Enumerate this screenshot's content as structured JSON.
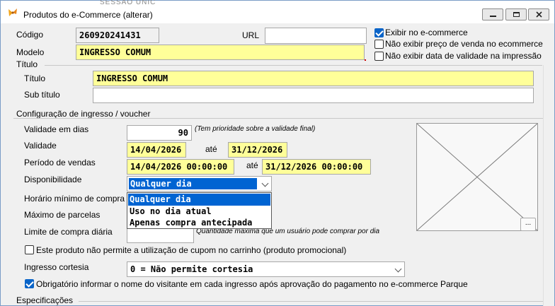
{
  "window": {
    "title": "Produtos do e-Commerce (alterar)",
    "background_text": "SESSAO UNIC"
  },
  "form": {
    "codigo_label": "Código",
    "codigo_value": "260920241431",
    "url_label": "URL",
    "url_value": "",
    "modelo_label": "Modelo",
    "modelo_value": "INGRESSO COMUM",
    "exibir_ecommerce_label": "Exibir no e-commerce",
    "exibir_ecommerce_checked": true,
    "nao_exibir_preco_label": "Não exibir preço de venda no ecommerce",
    "nao_exibir_preco_checked": false,
    "nao_exibir_validade_label": "Não exibir data de validade na impressão",
    "nao_exibir_validade_checked": false
  },
  "titulo_group": {
    "legend": "Título",
    "titulo_label": "Título",
    "titulo_value": "INGRESSO COMUM",
    "subtitulo_label": "Sub título",
    "subtitulo_value": ""
  },
  "config_group": {
    "legend": "Configuração de ingresso / voucher",
    "validade_dias_label": "Validade em dias",
    "validade_dias_value": "90",
    "validade_dias_hint": "(Tem prioridade sobre a validade final)",
    "validade_label": "Validade",
    "validade_inicio": "14/04/2026",
    "ate_label": "até",
    "validade_fim": "31/12/2026",
    "periodo_label": "Período de vendas",
    "periodo_inicio": "14/04/2026 00:00:00",
    "periodo_ate_label": "até",
    "periodo_fim": "31/12/2026 00:00:00",
    "disponibilidade_label": "Disponibilidade",
    "disponibilidade_value": "Qualquer dia",
    "disponibilidade_options": [
      "Qualquer dia",
      "Uso no dia atual",
      "Apenas compra antecipada"
    ],
    "horario_label": "Horário mínimo de compra",
    "parcelas_label": "Máximo de parcelas",
    "limite_label": "Limite de compra diária",
    "limite_hint": "Quantidade máxima que um usuário pode comprar por dia",
    "cupom_label": "Este produto não permite a utilização de cupom no carrinho (produto promocional)",
    "cupom_checked": false,
    "cortesia_label": "Ingresso cortesia",
    "cortesia_value": "0 = Não permite cortesia",
    "visitante_label": "Obrigatório informar o nome do visitante em cada ingresso após aprovação do pagamento no e-commerce Parque",
    "visitante_checked": true,
    "image_button_label": "..."
  },
  "especificacoes": {
    "legend": "Especificações"
  },
  "colors": {
    "yellow_field": "#ffff99",
    "selection_blue": "#0064d2",
    "checkbox_blue": "#0a64c8"
  }
}
